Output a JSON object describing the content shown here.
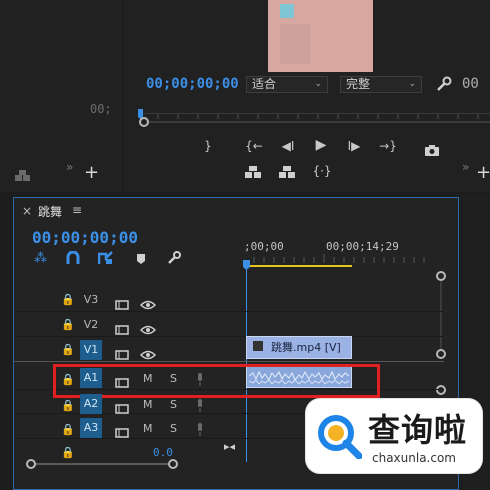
{
  "program_monitor": {
    "timecode": "00;00;00;00",
    "fit_label": "适合",
    "quality_label": "完整",
    "left_stub_value": "00;",
    "colors": {
      "accent": "#3b8fe6",
      "preview": "#d6a8a0"
    }
  },
  "timeline": {
    "close_glyph": "×",
    "sequence_name": "跳舞",
    "menu_glyph": "≡",
    "timecode": "00;00;00;00",
    "ruler_start": ";00;00",
    "ruler_mark": "00;00;14;29",
    "tracks": [
      {
        "lock": "🔒",
        "label": "V3",
        "active": false,
        "type": "video"
      },
      {
        "lock": "🔒",
        "label": "V2",
        "active": false,
        "type": "video"
      },
      {
        "lock": "🔒",
        "label": "V1",
        "active": true,
        "type": "video"
      },
      {
        "lock": "🔒",
        "label": "A1",
        "active": true,
        "type": "audio"
      },
      {
        "lock": "🔒",
        "label": "A2",
        "active": true,
        "type": "audio"
      },
      {
        "lock": "🔒",
        "label": "A3",
        "active": true,
        "type": "audio"
      }
    ],
    "audio_mute": "M",
    "audio_solo": "S",
    "master_lock": "🔒",
    "master_value": "0.0",
    "video_clip_name": "跳舞.mp4 [V]",
    "highlight_color": "#e0211f"
  },
  "watermark": {
    "text": "查询啦",
    "url": "chaxunla.com"
  }
}
